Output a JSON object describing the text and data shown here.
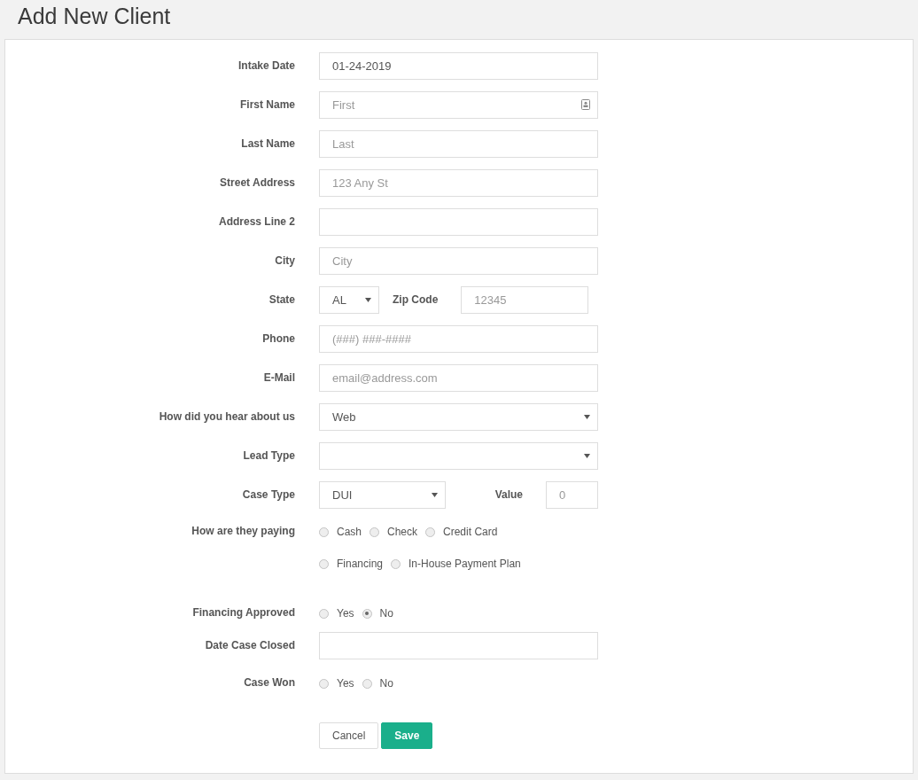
{
  "page": {
    "title": "Add New Client"
  },
  "rows": [
    {
      "kind": "text",
      "label": "Intake Date",
      "value": "01-24-2019"
    },
    {
      "kind": "text_icon",
      "label": "First Name",
      "placeholder": "First"
    },
    {
      "kind": "text",
      "label": "Last Name",
      "placeholder": "Last"
    },
    {
      "kind": "text",
      "label": "Street Address",
      "placeholder": "123 Any St"
    },
    {
      "kind": "text",
      "label": "Address Line 2"
    },
    {
      "kind": "text",
      "label": "City",
      "placeholder": "City"
    },
    {
      "kind": "state_zip",
      "label": "State",
      "value": "AL",
      "second_label": "Zip Code",
      "second_placeholder": "12345"
    },
    {
      "kind": "text",
      "label": "Phone",
      "placeholder": "(###) ###-####"
    },
    {
      "kind": "text",
      "label": "E-Mail",
      "placeholder": "email@address.com"
    },
    {
      "kind": "select",
      "label": "How did you hear about us",
      "value": "Web"
    },
    {
      "kind": "select",
      "label": "Lead Type"
    },
    {
      "kind": "select_value",
      "label": "Case Type",
      "value": "DUI",
      "second_label": "Value",
      "second_placeholder": "0"
    },
    {
      "kind": "radio",
      "label": "How are they paying",
      "lines": [
        [
          {
            "label": "Cash",
            "selected": false
          },
          {
            "label": "Check",
            "selected": false
          },
          {
            "label": "Credit Card",
            "selected": false
          }
        ],
        [
          {
            "label": "Financing",
            "selected": false
          },
          {
            "label": "In-House Payment Plan",
            "selected": false
          }
        ]
      ]
    },
    {
      "kind": "radio",
      "label": "Financing Approved",
      "lines": [
        [
          {
            "label": "Yes",
            "selected": false
          },
          {
            "label": "No",
            "selected": true
          }
        ]
      ]
    },
    {
      "kind": "text",
      "label": "Date Case Closed"
    },
    {
      "kind": "radio",
      "label": "Case Won",
      "lines": [
        [
          {
            "label": "Yes",
            "selected": false
          },
          {
            "label": "No",
            "selected": false
          }
        ]
      ]
    }
  ],
  "buttons": [
    {
      "kind": "plain",
      "label": "Cancel"
    },
    {
      "kind": "primary",
      "label": "Save"
    }
  ]
}
